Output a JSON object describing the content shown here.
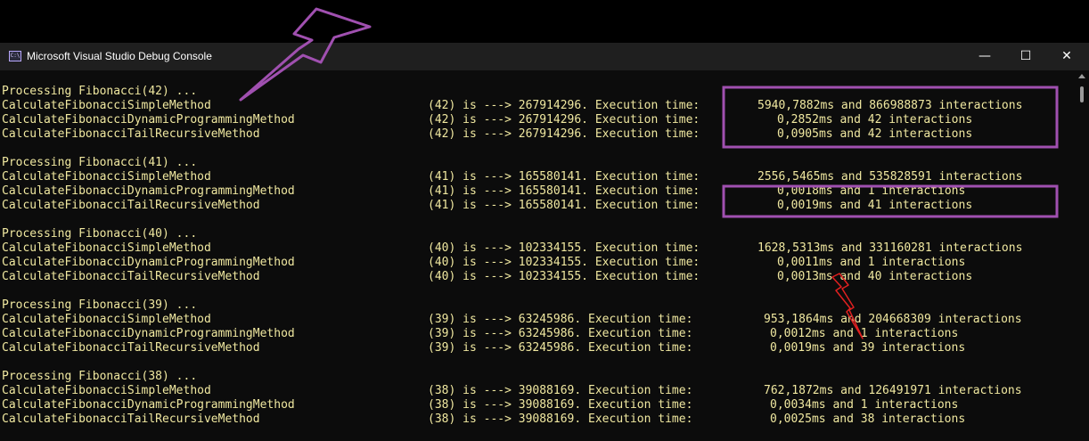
{
  "window": {
    "title": "Microsoft Visual Studio Debug Console",
    "icon": "console-app-icon",
    "icon_text": "C:\\",
    "controls": {
      "minimize": "—",
      "maximize": "☐",
      "close": "✕"
    }
  },
  "colors": {
    "console_text": "#cccccc",
    "console_text_yellow": "#f0e8a0",
    "console_bg": "#0c0c0c",
    "annotation_purple": "#a050b0",
    "annotation_red": "#e02020"
  },
  "console": {
    "blocks": [
      {
        "header": "Processing Fibonacci(42) ...",
        "rows": [
          {
            "method": "CalculateFibonacciSimpleMethod",
            "result": "(42) is ---> 267914296. Execution time:",
            "stats": "5940,7882ms and 866988873 interactions"
          },
          {
            "method": "CalculateFibonacciDynamicProgrammingMethod",
            "result": "(42) is ---> 267914296. Execution time:",
            "stats": "0,2852ms and 42 interactions"
          },
          {
            "method": "CalculateFibonacciTailRecursiveMethod",
            "result": "(42) is ---> 267914296. Execution time:",
            "stats": "0,0905ms and 42 interactions"
          }
        ]
      },
      {
        "header": "Processing Fibonacci(41) ...",
        "rows": [
          {
            "method": "CalculateFibonacciSimpleMethod",
            "result": "(41) is ---> 165580141. Execution time:",
            "stats": "2556,5465ms and 535828591 interactions"
          },
          {
            "method": "CalculateFibonacciDynamicProgrammingMethod",
            "result": "(41) is ---> 165580141. Execution time:",
            "stats": "0,0018ms and 1 interactions"
          },
          {
            "method": "CalculateFibonacciTailRecursiveMethod",
            "result": "(41) is ---> 165580141. Execution time:",
            "stats": "0,0019ms and 41 interactions"
          }
        ]
      },
      {
        "header": "Processing Fibonacci(40) ...",
        "rows": [
          {
            "method": "CalculateFibonacciSimpleMethod",
            "result": "(40) is ---> 102334155. Execution time:",
            "stats": "1628,5313ms and 331160281 interactions"
          },
          {
            "method": "CalculateFibonacciDynamicProgrammingMethod",
            "result": "(40) is ---> 102334155. Execution time:",
            "stats": "0,0011ms and 1 interactions"
          },
          {
            "method": "CalculateFibonacciTailRecursiveMethod",
            "result": "(40) is ---> 102334155. Execution time:",
            "stats": "0,0013ms and 40 interactions"
          }
        ]
      },
      {
        "header": "Processing Fibonacci(39) ...",
        "rows": [
          {
            "method": "CalculateFibonacciSimpleMethod",
            "result": "(39) is ---> 63245986. Execution time:",
            "stats": "953,1864ms and 204668309 interactions"
          },
          {
            "method": "CalculateFibonacciDynamicProgrammingMethod",
            "result": "(39) is ---> 63245986. Execution time:",
            "stats": "0,0012ms and 1 interactions"
          },
          {
            "method": "CalculateFibonacciTailRecursiveMethod",
            "result": "(39) is ---> 63245986. Execution time:",
            "stats": "0,0019ms and 39 interactions"
          }
        ]
      },
      {
        "header": "Processing Fibonacci(38) ...",
        "rows": [
          {
            "method": "CalculateFibonacciSimpleMethod",
            "result": "(38) is ---> 39088169. Execution time:",
            "stats": "762,1872ms and 126491971 interactions"
          },
          {
            "method": "CalculateFibonacciDynamicProgrammingMethod",
            "result": "(38) is ---> 39088169. Execution time:",
            "stats": "0,0034ms and 1 interactions"
          },
          {
            "method": "CalculateFibonacciTailRecursiveMethod",
            "result": "(38) is ---> 39088169. Execution time:",
            "stats": "0,0025ms and 38 interactions"
          }
        ]
      }
    ]
  }
}
